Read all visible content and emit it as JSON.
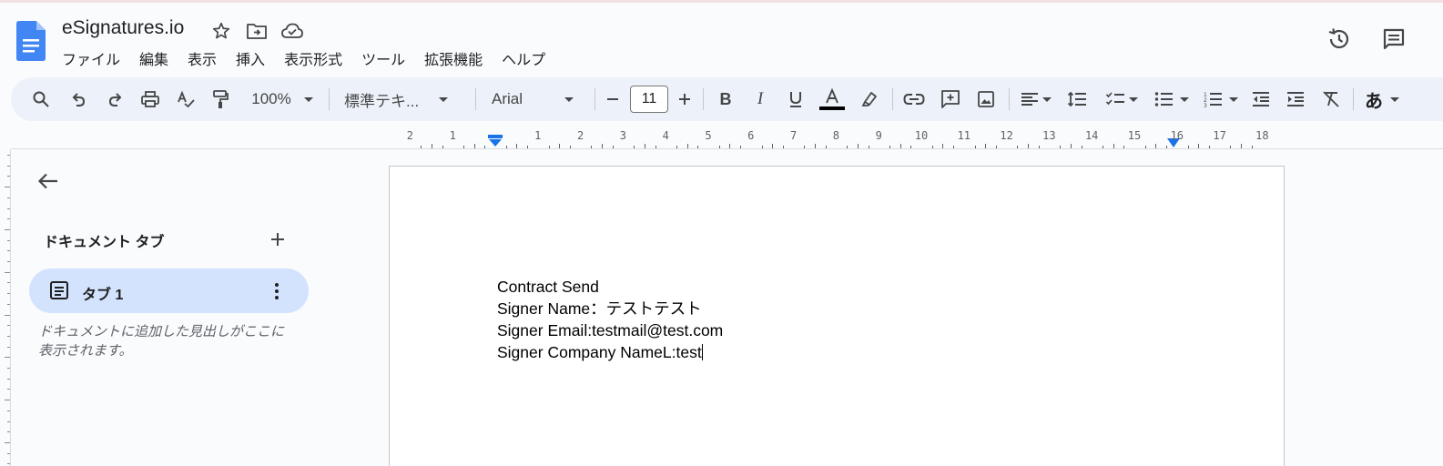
{
  "app": {
    "title": "eSignatures.io",
    "menu": [
      "ファイル",
      "編集",
      "表示",
      "挿入",
      "表示形式",
      "ツール",
      "拡張機能",
      "ヘルプ"
    ]
  },
  "toolbar": {
    "zoom": "100%",
    "style": "標準テキ...",
    "font": "Arial",
    "font_size": "11",
    "ime": "あ"
  },
  "ruler": {
    "left_numbers": [
      "2",
      "1"
    ],
    "right_numbers": [
      "1",
      "2",
      "3",
      "4",
      "5",
      "6",
      "7",
      "8",
      "9",
      "10",
      "11",
      "12",
      "13",
      "14",
      "15",
      "16",
      "17",
      "18"
    ]
  },
  "sidebar": {
    "heading": "ドキュメント タブ",
    "tabs": [
      {
        "label": "タブ 1"
      }
    ],
    "hint": "ドキュメントに追加した見出しがここに表示されます。"
  },
  "document": {
    "lines": [
      "Contract Send",
      "Signer Name：テストテスト",
      "Signer Email:testmail@test.com",
      "Signer Company NameL:test"
    ]
  },
  "colors": {
    "accent": "#1a73e8",
    "toolbar_bg": "#edf2fa",
    "tab_selected": "#d3e3fd"
  }
}
